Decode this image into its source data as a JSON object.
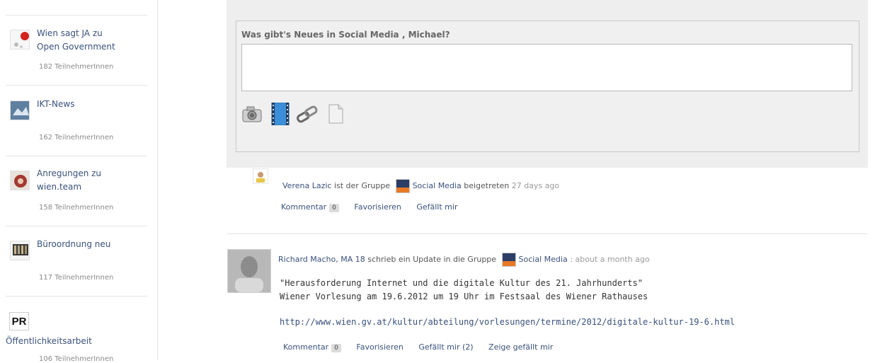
{
  "sidebar": {
    "groups": [
      {
        "name_line1": "Wien sagt JA zu",
        "name_line2": "Open Government",
        "count": "182 TeilnehmerInnen",
        "icon": "open-government-icon"
      },
      {
        "name_line1": "IKT-News",
        "name_line2": "",
        "count": "162 TeilnehmerInnen",
        "icon": "ikt-news-icon"
      },
      {
        "name_line1": "Anregungen zu",
        "name_line2": "wien.team",
        "count": "158 TeilnehmerInnen",
        "icon": "anregungen-icon"
      },
      {
        "name_line1": "Büroordnung neu",
        "name_line2": "",
        "count": "117 TeilnehmerInnen",
        "icon": "bueroordnung-icon"
      }
    ],
    "pr_group": {
      "icon_text": "PR",
      "name": "Öffentlichkeitsarbeit",
      "count": "106 TeilnehmerInnen"
    }
  },
  "status": {
    "prompt": "Was gibt's Neues in Social Media , Michael?",
    "text_value": "",
    "attachments": [
      "camera-icon",
      "video-icon",
      "link-icon",
      "document-icon"
    ]
  },
  "activity": [
    {
      "user": "Verena Lazic",
      "verb": "ist der Gruppe",
      "group": "Social Media",
      "verb_after": "beigetreten",
      "time": "27 days ago",
      "actions": {
        "comment": "Kommentar",
        "comment_count": "0",
        "favorite": "Favorisieren",
        "like": "Gefällt mir"
      }
    },
    {
      "user": "Richard Macho, MA 18",
      "verb": "schrieb ein Update in die Gruppe",
      "group": "Social Media",
      "separator": ":",
      "time": "about a month ago",
      "post_line1": "\"Herausforderung Internet und die digitale Kultur des 21. Jahrhunderts\"",
      "post_line2": "Wiener Vorlesung am 19.6.2012 um 19 Uhr im Festsaal des Wiener Rathauses",
      "post_link": "http://www.wien.gv.at/kultur/abteilung/vorlesungen/termine/2012/digitale-kultur-19-6.html",
      "actions": {
        "comment": "Kommentar",
        "comment_count": "0",
        "favorite": "Favorisieren",
        "like": "Gefällt mir (2)",
        "show_likes": "Zeige gefällt mir"
      }
    }
  ],
  "colors": {
    "link": "#39517b",
    "muted": "#999999",
    "panel": "#eeeeee"
  }
}
